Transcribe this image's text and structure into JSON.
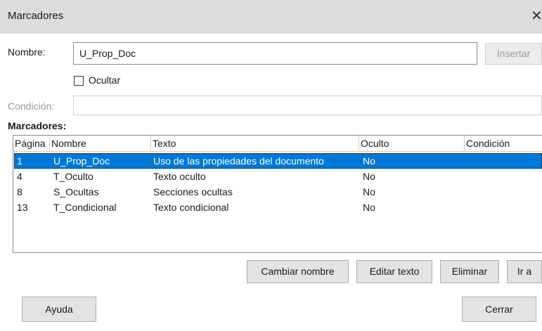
{
  "window": {
    "title": "Marcadores",
    "close_glyph": "✕"
  },
  "form": {
    "nombre_label": "Nombre:",
    "nombre_value": "U_Prop_Doc",
    "insertar_label": "Insertar",
    "ocultar_label": "Ocultar",
    "ocultar_checked": false,
    "condicion_label": "Condición:",
    "condicion_value": ""
  },
  "list": {
    "heading": "Marcadores:",
    "columns": [
      "Página",
      "Nombre",
      "Texto",
      "Oculto",
      "Condición"
    ],
    "rows": [
      {
        "pagina": "1",
        "nombre": "U_Prop_Doc",
        "texto": "Uso de las propiedades del documento",
        "oculto": "No",
        "condicion": "",
        "selected": true
      },
      {
        "pagina": "4",
        "nombre": "T_Oculto",
        "texto": "Texto oculto",
        "oculto": "No",
        "condicion": ""
      },
      {
        "pagina": "8",
        "nombre": "S_Ocultas",
        "texto": "Secciones ocultas",
        "oculto": "No",
        "condicion": ""
      },
      {
        "pagina": "13",
        "nombre": "T_Condicional",
        "texto": "Texto condicional",
        "oculto": "No",
        "condicion": ""
      }
    ]
  },
  "actions": {
    "cambiar_nombre": "Cambiar nombre",
    "editar_texto": "Editar texto",
    "eliminar": "Eliminar",
    "ir_a": "Ir a"
  },
  "footer": {
    "ayuda": "Ayuda",
    "cerrar": "Cerrar"
  },
  "colors": {
    "selection": "#0078d7",
    "titlebar": "#dcdcdc"
  }
}
